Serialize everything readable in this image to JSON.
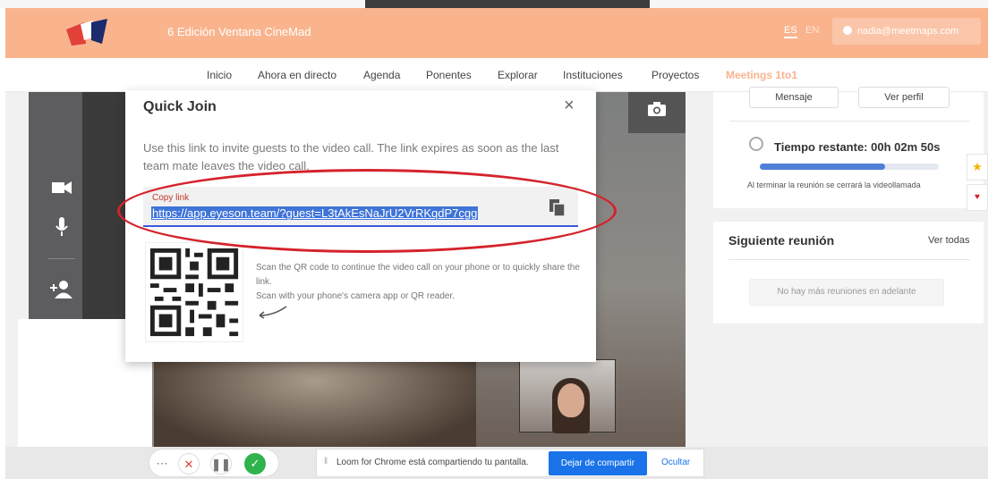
{
  "header": {
    "event_title": "6 Edición Ventana CineMad",
    "lang_es": "ES",
    "lang_en": "EN",
    "user_email": "nadia@meetmaps.com"
  },
  "nav": {
    "items": [
      "Inicio",
      "Ahora en directo",
      "Agenda",
      "Ponentes",
      "Explorar",
      "Instituciones",
      "Proyectos",
      "Meetings 1to1"
    ],
    "active": "Meetings 1to1"
  },
  "modal": {
    "title": "Quick Join",
    "close": "×",
    "description": "Use this link to invite guests to the video call. The link expires as soon as the last team mate leaves the video call.",
    "copy_label": "Copy link",
    "link": "https://app.eyeson.team/?guest=L3tAkEsNaJrU2VrRKqdP7cgg",
    "qr_text_1": "Scan the QR code to continue the video call on your phone or to quickly share the link.",
    "qr_text_2": "Scan with your phone's camera app or QR reader."
  },
  "sidebar": {
    "btn_message": "Mensaje",
    "btn_profile": "Ver perfil",
    "time_left": "Tiempo restante: 00h 02m 50s",
    "time_progress": 0.7,
    "time_note": "Al terminar la reunión se cerrará la videollamada",
    "next_title": "Siguiente reunión",
    "see_all": "Ver todas",
    "no_meetings": "No hay más reuniones en adelante"
  },
  "loom": {
    "text": "Loom for Chrome está compartiendo tu pantalla.",
    "stop": "Dejar de compartir",
    "hide": "Ocultar"
  },
  "colors": {
    "header": "#f9b48e",
    "accent_blue": "#1a73e8",
    "annotation_red": "#d4232c"
  }
}
